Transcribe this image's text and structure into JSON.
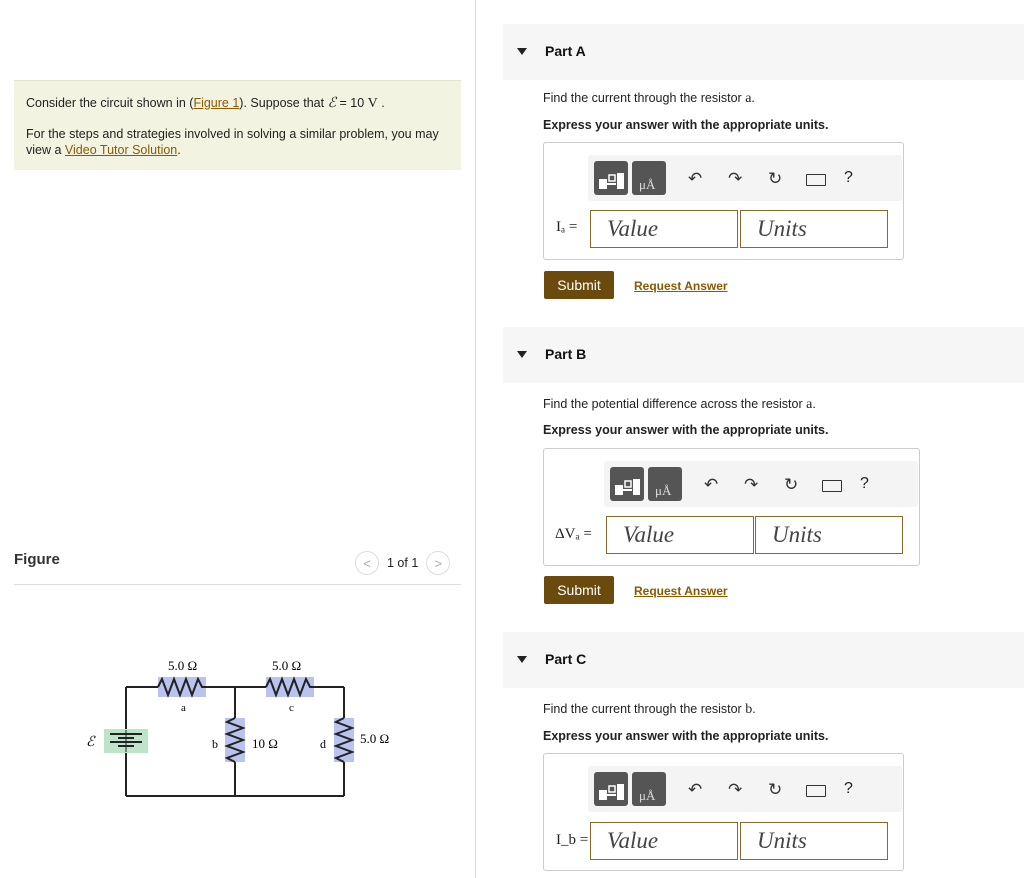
{
  "problem": {
    "line1_prefix": "Consider the circuit shown in (",
    "figure_link": "Figure 1",
    "line1_mid": "). Suppose that ",
    "emf_symbol": "ℰ",
    "emf_eq": " = 10 ",
    "emf_unit": "V",
    "line1_end": " .",
    "line2": "For the steps and strategies involved in solving a similar problem, you may view a ",
    "video_link": "Video Tutor Solution",
    "line2_end": "."
  },
  "figure": {
    "title": "Figure",
    "pager": "1 of 1",
    "prev": "<",
    "next": ">",
    "labels": {
      "emf": "ℰ",
      "ra_value": "5.0 Ω",
      "ra_name": "a",
      "rc_value": "5.0 Ω",
      "rc_name": "c",
      "rb_value": "10 Ω",
      "rb_name": "b",
      "rd_value": "5.0 Ω",
      "rd_name": "d"
    }
  },
  "parts": [
    {
      "title": "Part A",
      "question_prefix": "Find the current through the resistor ",
      "question_var": "a",
      "question_end": ".",
      "instruction": "Express your answer with the appropriate units.",
      "var_label": "Iₐ =",
      "value_placeholder": "Value",
      "units_placeholder": "Units",
      "submit": "Submit",
      "request": "Request Answer"
    },
    {
      "title": "Part B",
      "question_prefix": "Find the potential difference across the resistor ",
      "question_var": "a",
      "question_end": ".",
      "instruction": "Express your answer with the appropriate units.",
      "var_label": "ΔVₐ =",
      "value_placeholder": "Value",
      "units_placeholder": "Units",
      "submit": "Submit",
      "request": "Request Answer"
    },
    {
      "title": "Part C",
      "question_prefix": "Find the current through the resistor ",
      "question_var": "b",
      "question_end": ".",
      "instruction": "Express your answer with the appropriate units.",
      "var_label": "I_b =",
      "value_placeholder": "Value",
      "units_placeholder": "Units"
    }
  ],
  "toolbar": {
    "units_icon_label": "μÅ",
    "help": "?",
    "icons": [
      "templates-icon",
      "units-icon",
      "undo-icon",
      "redo-icon",
      "reset-icon",
      "keyboard-icon",
      "help-icon"
    ]
  },
  "colors": {
    "accent": "#6b4a0e",
    "link": "#8a5a00",
    "problem_bg": "#f3f3e1",
    "resistor_highlight": "#b9c3ef",
    "battery_highlight": "#bfe3c8"
  }
}
